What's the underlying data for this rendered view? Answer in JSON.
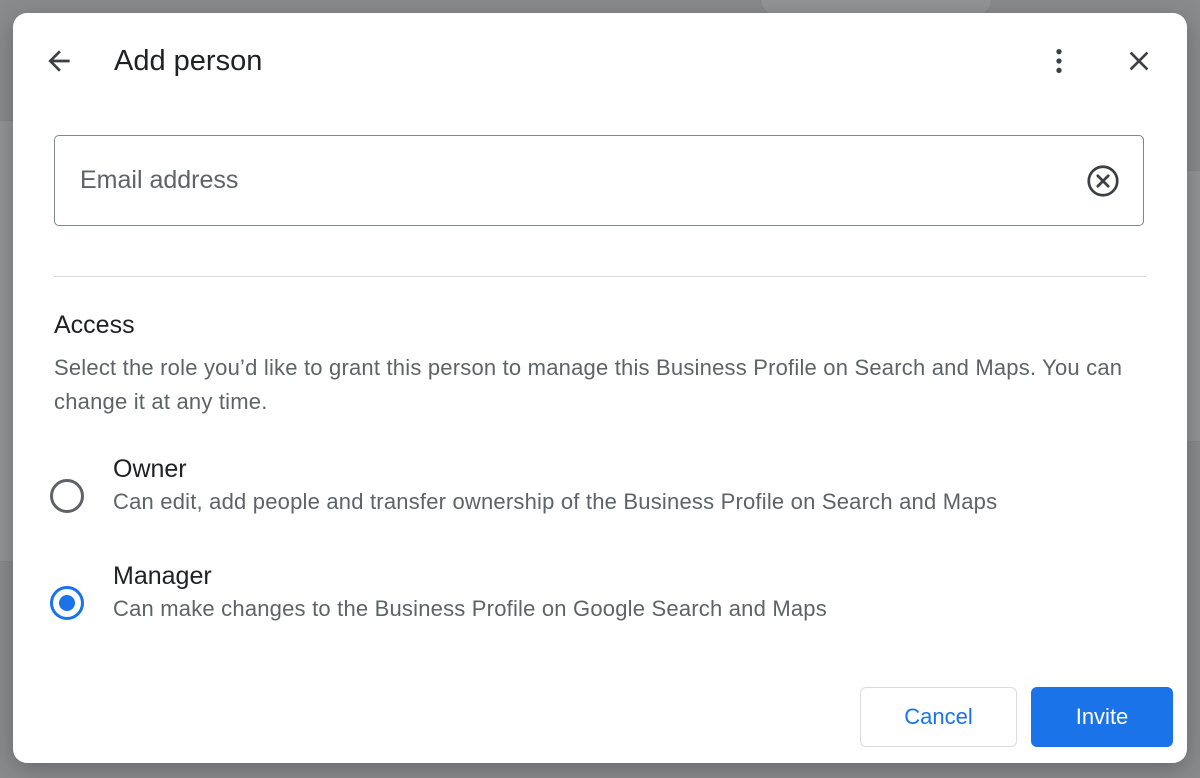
{
  "dialog": {
    "title": "Add person",
    "back_icon": "arrow-back-icon",
    "more_icon": "more-vert-icon",
    "close_icon": "close-icon"
  },
  "email": {
    "placeholder": "Email address",
    "value": "",
    "clear_icon": "cancel-circle-icon"
  },
  "access": {
    "heading": "Access",
    "description": "Select the role you’d like to grant this person to manage this Business Profile on Search and Maps. You can change it at any time.",
    "roles": [
      {
        "title": "Owner",
        "description": "Can edit, add people and transfer ownership of the Business Profile on Search and Maps",
        "selected": false
      },
      {
        "title": "Manager",
        "description": "Can make changes to the Business Profile on Google Search and Maps",
        "selected": true
      }
    ]
  },
  "actions": {
    "cancel_label": "Cancel",
    "invite_label": "Invite"
  },
  "colors": {
    "accent": "#1a73e8",
    "text_primary": "#202124",
    "text_secondary": "#5f6368",
    "divider": "#dadce0",
    "overlay": "#8a8b8d"
  }
}
